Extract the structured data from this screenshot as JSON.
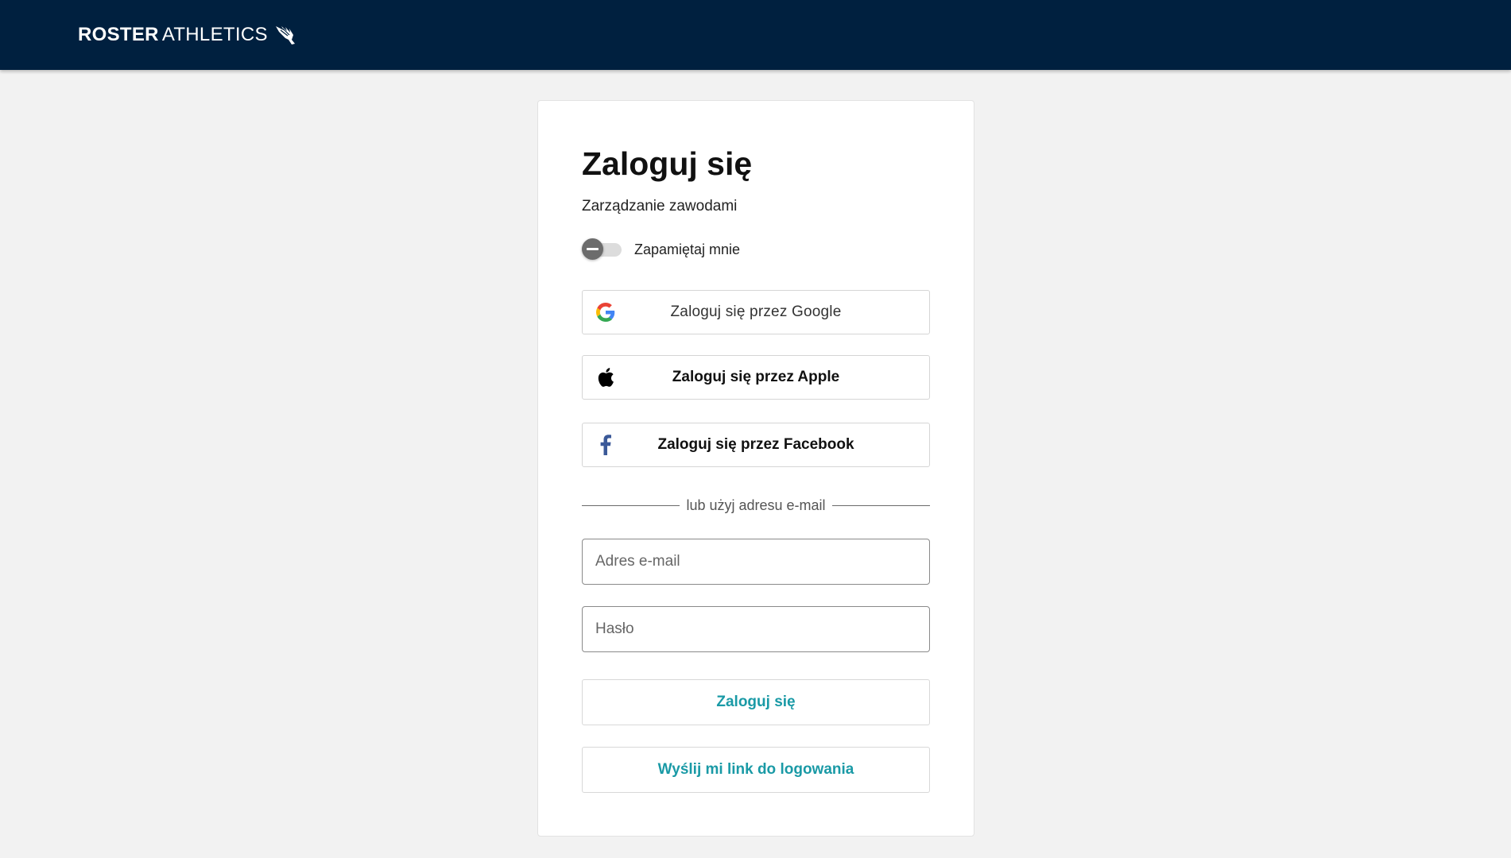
{
  "header": {
    "brand_bold": "ROSTER",
    "brand_light": "ATHLETICS",
    "logo_icon": "winged-foot-icon",
    "background": "#00203f"
  },
  "login": {
    "title": "Zaloguj się",
    "subtitle": "Zarządzanie zawodami",
    "remember_label": "Zapamiętaj mnie",
    "remember_checked": false,
    "google_label": "Zaloguj się przez Google",
    "apple_label": "Zaloguj się przez Apple",
    "facebook_label": "Zaloguj się przez Facebook",
    "divider_text": "lub użyj adresu e-mail",
    "email_placeholder": "Adres e-mail",
    "email_value": "",
    "password_placeholder": "Hasło",
    "password_value": "",
    "submit_label": "Zaloguj się",
    "magic_link_label": "Wyślij mi link do logowania",
    "accent_color": "#1a9aa6"
  }
}
